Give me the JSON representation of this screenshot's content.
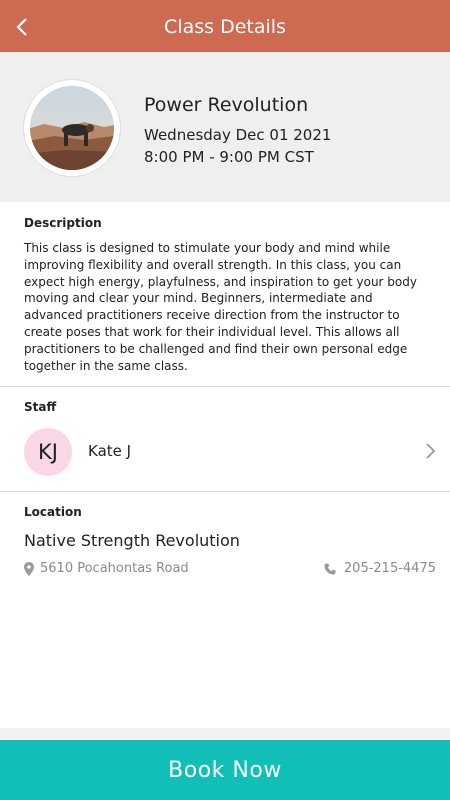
{
  "header": {
    "title": "Class Details"
  },
  "class": {
    "name": "Power Revolution",
    "date": "Wednesday Dec 01 2021",
    "time": "8:00 PM - 9:00 PM CST"
  },
  "description": {
    "label": "Description",
    "text": "This class is designed to stimulate your body and mind while improving flexibility and overall strength. In this class, you can expect high energy, playfulness, and inspiration to get your body moving and clear your mind. Beginners, intermediate and advanced practitioners receive direction from the instructor to create poses that work for their individual level. This allows all practitioners to be challenged and find their own personal edge together in the same class."
  },
  "staff": {
    "label": "Staff",
    "initials": "KJ",
    "name": "Kate J"
  },
  "location": {
    "label": "Location",
    "name": "Native Strength Revolution",
    "address": "5610 Pocahontas Road",
    "phone": "205-215-4475"
  },
  "footer": {
    "book_label": "Book Now"
  },
  "colors": {
    "header": "#cf6a52",
    "book_button": "#10bfb8",
    "avatar_bg": "#fad7e6"
  }
}
